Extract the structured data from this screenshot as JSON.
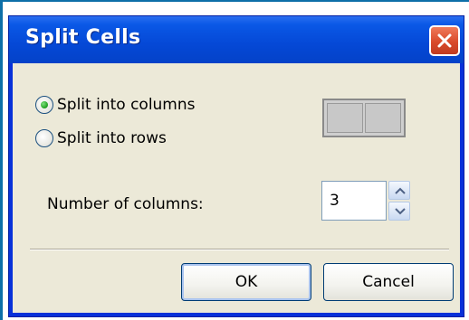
{
  "dialog": {
    "title": "Split Cells"
  },
  "options": {
    "split_columns_label": "Split into columns",
    "split_rows_label": "Split into rows",
    "selected": "columns"
  },
  "count": {
    "label": "Number of columns:",
    "value": "3"
  },
  "buttons": {
    "ok": "OK",
    "cancel": "Cancel"
  },
  "colors": {
    "titlebar": "#0548d6",
    "client": "#ece9d8",
    "close": "#d94a2a"
  },
  "icons": {
    "close": "close-icon",
    "spin_up": "chevron-up-icon",
    "spin_down": "chevron-down-icon",
    "preview": "split-columns-preview-icon"
  }
}
